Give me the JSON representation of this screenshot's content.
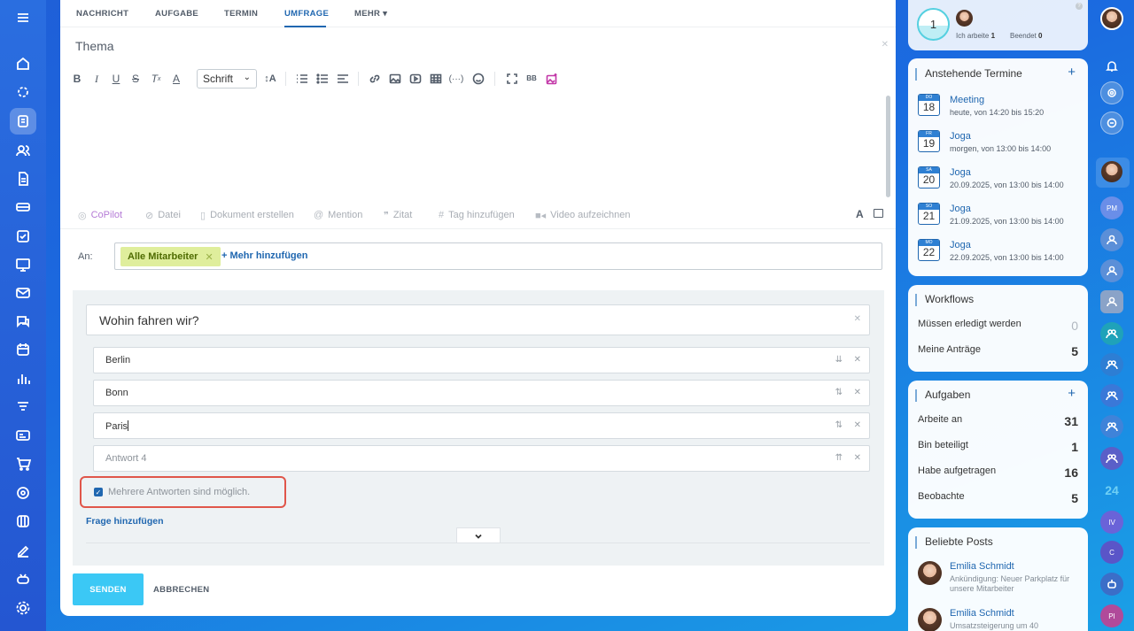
{
  "tabs": {
    "t1": "NACHRICHT",
    "t2": "AUFGABE",
    "t3": "TERMIN",
    "t4": "UMFRAGE",
    "t5": "MEHR"
  },
  "subject_placeholder": "Thema",
  "toolbar": {
    "font": "Schrift"
  },
  "attachments": {
    "copilot": "CoPilot",
    "file": "Datei",
    "doc": "Dokument erstellen",
    "mention": "Mention",
    "quote": "Zitat",
    "tag": "Tag hinzufügen",
    "video": "Video aufzeichnen",
    "fmt": "A"
  },
  "recipients": {
    "label": "An:",
    "chip": "Alle Mitarbeiter",
    "add": "+ Mehr hinzufügen"
  },
  "poll": {
    "question": "Wohin fahren wir?",
    "answers": [
      "Berlin",
      "Bonn",
      "Paris"
    ],
    "answer_placeholder": "Antwort  4",
    "multiple": "Mehrere Antworten sind möglich.",
    "add_question": "Frage hinzufügen"
  },
  "actions": {
    "send": "SENDEN",
    "cancel": "ABBRECHEN"
  },
  "status": {
    "count": "1",
    "working_label": "Ich arbeite",
    "working_val": "1",
    "done_label": "Beendet",
    "done_val": "0"
  },
  "events": {
    "title": "Anstehende Termine",
    "items": [
      {
        "dw": "DO",
        "day": "18",
        "title": "Meeting",
        "sub": "heute, von 14:20 bis 15:20"
      },
      {
        "dw": "FR",
        "day": "19",
        "title": "Joga",
        "sub": "morgen, von 13:00 bis 14:00"
      },
      {
        "dw": "SA",
        "day": "20",
        "title": "Joga",
        "sub": "20.09.2025, von 13:00 bis 14:00"
      },
      {
        "dw": "SO",
        "day": "21",
        "title": "Joga",
        "sub": "21.09.2025, von 13:00 bis 14:00"
      },
      {
        "dw": "MO",
        "day": "22",
        "title": "Joga",
        "sub": "22.09.2025, von 13:00 bis 14:00"
      }
    ]
  },
  "workflows": {
    "title": "Workflows",
    "rows": [
      {
        "label": "Müssen erledigt werden",
        "n": "0"
      },
      {
        "label": "Meine Anträge",
        "n": "5"
      }
    ]
  },
  "tasks": {
    "title": "Aufgaben",
    "rows": [
      {
        "label": "Arbeite an",
        "n": "31"
      },
      {
        "label": "Bin beteiligt",
        "n": "1"
      },
      {
        "label": "Habe aufgetragen",
        "n": "16"
      },
      {
        "label": "Beobachte",
        "n": "5"
      }
    ]
  },
  "posts": {
    "title": "Beliebte Posts",
    "items": [
      {
        "name": "Emilia Schmidt",
        "text": "Ankündigung: Neuer Parkplatz für unsere Mitarbeiter"
      },
      {
        "name": "Emilia Schmidt",
        "text": "Umsatzsteigerung um 40"
      }
    ]
  },
  "rightbar": {
    "pm": "PM",
    "b24": "24",
    "iv": "IV",
    "c": "C",
    "pi": "PI"
  }
}
